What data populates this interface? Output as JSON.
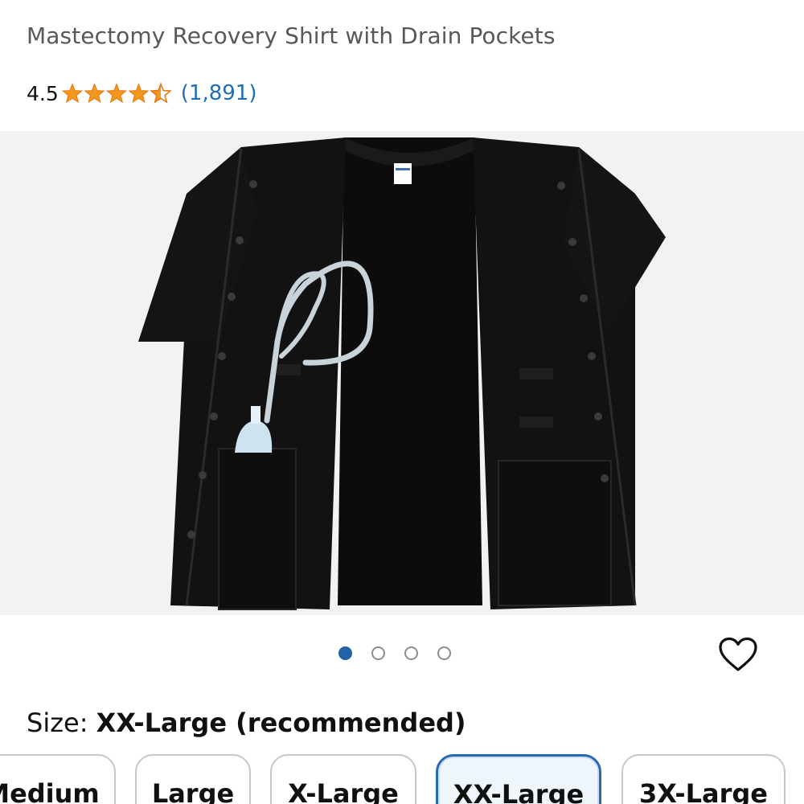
{
  "product": {
    "title": "Mastectomy Recovery Shirt with Drain Pockets",
    "rating_value": "4.5",
    "rating_stars": 4.5,
    "review_count": "(1,891)"
  },
  "gallery": {
    "image_icon": "product-photo",
    "slide_count": 4,
    "active_slide": 1
  },
  "wishlist": {
    "icon": "heart-outline-icon"
  },
  "size": {
    "label": "Size:",
    "selected": "XX-Large (recommended)",
    "options": [
      "Medium",
      "Large",
      "X-Large",
      "XX-Large",
      "3X-Large"
    ]
  },
  "colors": {
    "star": "#f3961c",
    "link": "#1f6db3",
    "selected_border": "#2c67b1",
    "active_dot": "#2462a8"
  }
}
